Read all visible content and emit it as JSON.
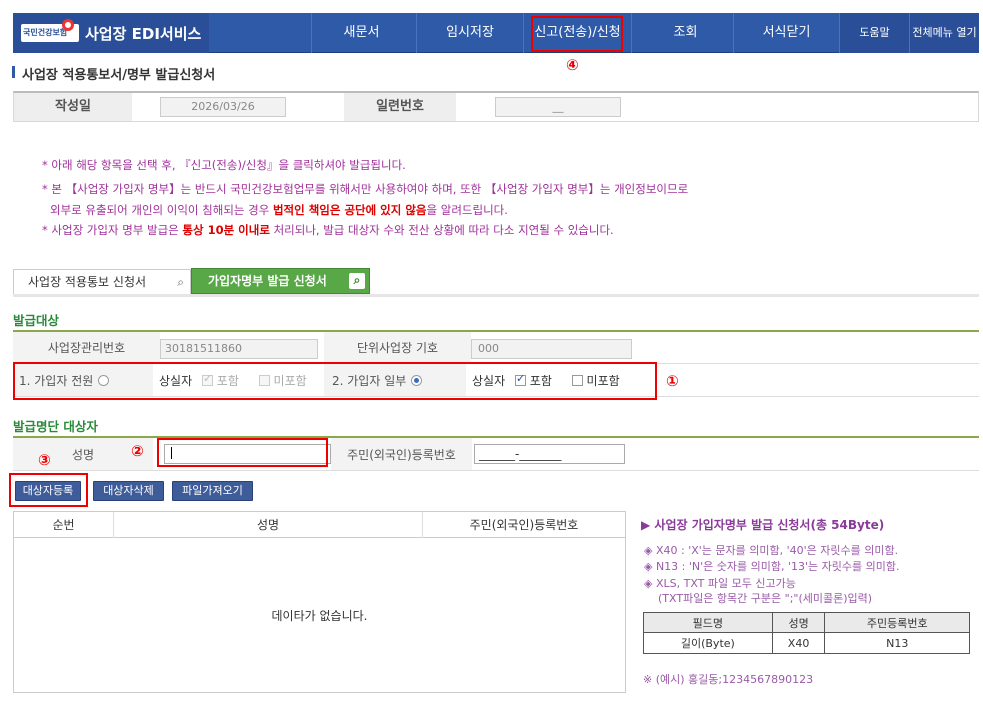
{
  "header": {
    "logo_text": "국민건강보험",
    "app_title": "사업장 EDI서비스",
    "nav": [
      "새문서",
      "임시저장",
      "신고(전송)/신청",
      "조회",
      "서식닫기"
    ],
    "help": "도움말",
    "all_menu": "전체메뉴 열기"
  },
  "page": {
    "title": "사업장 적용통보서/명부 발급신청서",
    "date_label": "작성일",
    "date_value": "2026/03/26",
    "serial_label": "일련번호",
    "serial_value": "__"
  },
  "notices": {
    "n1": "* 아래 해당 항목을 선택 후, 『신고(전송)/신청』을 클릭하셔야 발급됩니다.",
    "n2a": "* 본 【사업장 가입자 명부】는 반드시 국민건강보험업무를 위해서만 사용하여야 하며, 또한 【사업장 가입자 명부】는 개인정보이므로",
    "n2b_pre": "외부로 유출되어 개인의 이익이 침해되는 경우 ",
    "n2b_bold": "법적인 책임은 공단에 있지 않음",
    "n2b_post": "을 알려드립니다.",
    "n3_pre": "* 사업장 가입자 명부 발급은 ",
    "n3_bold": "통상 10분 이내로",
    "n3_post": " 처리되나, 발급 대상자 수와 전산 상황에 따라 다소 지연될 수 있습니다."
  },
  "tabs": {
    "tab1": "사업장 적용통보 신청서",
    "tab2": "가입자명부 발급 신청서"
  },
  "target": {
    "section": "발급대상",
    "mgmt_label": "사업장관리번호",
    "mgmt_value": "30181511860",
    "unit_label": "단위사업장 기호",
    "unit_value": "000",
    "opt1": "1. 가입자 전원",
    "lost_label": "상실자",
    "include": "포함",
    "exclude": "미포함",
    "opt2": "2. 가입자 일부"
  },
  "list_section": {
    "section": "발급명단 대상자",
    "name_label": "성명",
    "name_value": "",
    "rrn_label": "주민(외국인)등록번호",
    "rrn_value": "______-_______"
  },
  "buttons": {
    "register": "대상자등록",
    "delete": "대상자삭제",
    "import": "파일가져오기"
  },
  "grid": {
    "headers": [
      "순번",
      "성명",
      "주민(외국인)등록번호"
    ],
    "empty": "데이타가 없습니다."
  },
  "side": {
    "title": "▶ 사업장 가입자명부 발급 신청서(총 54Byte)",
    "notes": [
      "◈ X40 : 'X'는 문자를 의미함, '40'은 자릿수를 의미함.",
      "◈ N13 : 'N'은 숫자를 의미함, '13'는 자릿수를 의미함.",
      "◈ XLS, TXT 파일 모두 신고가능",
      "(TXT파일은 항목간 구분은 \";\"(세미콜론)입력)"
    ],
    "spec_headers": [
      "필드명",
      "성명",
      "주민등록번호"
    ],
    "spec_row": [
      "길이(Byte)",
      "X40",
      "N13"
    ],
    "example": "※ (예시) 홍길동;1234567890123"
  },
  "markers": [
    "①",
    "②",
    "③",
    "④"
  ]
}
